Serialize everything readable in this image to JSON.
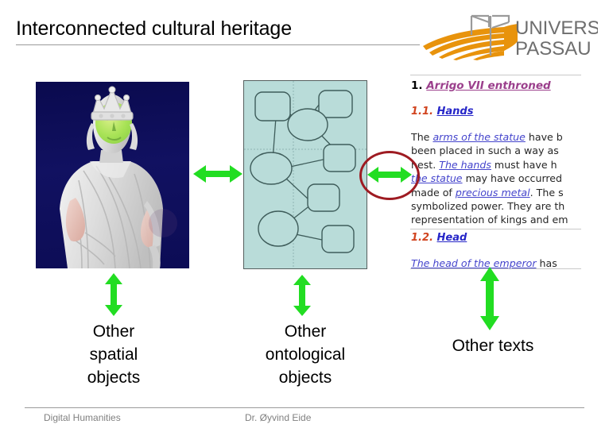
{
  "slide": {
    "title": "Interconnected cultural heritage"
  },
  "logo": {
    "line1": "UNIVERSITÄT",
    "line2": "PASSAU",
    "name": "university-passau-logo",
    "text_color": "#6e6e6e",
    "mark_color": "#e8930c"
  },
  "statue": {
    "name": "arrigo-vii-3d-scan",
    "background_color": "#0d0d5c",
    "marble_color": "#e2e2e2",
    "face_highlight_color": "#9fe05a",
    "arm_highlight_color": "#e8bfb5"
  },
  "ontology": {
    "name": "ontology-graph-panel",
    "panel_color": "#b9dcd9",
    "border_color": "#555f5e",
    "node_color": "#41615f"
  },
  "text_panel": {
    "heading1_number": "1.",
    "heading1_text": "Arrigo VII enthroned",
    "heading1_color": "#9b3f8c",
    "heading2a_number": "1.1.",
    "heading2a_text": "Hands",
    "heading2b_number": "1.2.",
    "heading2b_text": "Head",
    "heading_num_color": "#d1441f",
    "heading_link_color": "#2626c8",
    "paragraph1_lines": [
      {
        "parts": [
          {
            "t": "The ",
            "link": false
          },
          {
            "t": "arms of the statue",
            "link": true
          },
          {
            "t": " have b",
            "link": false
          }
        ]
      },
      {
        "parts": [
          {
            "t": "been placed in such a way as",
            "link": false
          }
        ]
      },
      {
        "parts": [
          {
            "t": "hest. ",
            "link": false
          },
          {
            "t": "The hands",
            "link": true
          },
          {
            "t": " must have h",
            "link": false
          }
        ]
      },
      {
        "parts": [
          {
            "t": "the statue",
            "link": true
          },
          {
            "t": " may have occurred",
            "link": false
          }
        ]
      },
      {
        "parts": [
          {
            "t": "made of ",
            "link": false
          },
          {
            "t": "precious metal",
            "link": true
          },
          {
            "t": ". The s",
            "link": false
          }
        ]
      },
      {
        "parts": [
          {
            "t": "symbolized power. They are th",
            "link": false
          }
        ]
      },
      {
        "parts": [
          {
            "t": "representation of kings and em",
            "link": false
          }
        ]
      }
    ],
    "paragraph2_lines": [
      {
        "parts": [
          {
            "t": "The head of the emperor",
            "link": true
          },
          {
            "t": " has",
            "link": false
          }
        ]
      }
    ]
  },
  "arrows": {
    "color": "#22dd22",
    "statue_to_ontology": "double-headed-horizontal-arrow",
    "ontology_to_text": "double-headed-horizontal-arrow",
    "statue_to_spatial": "double-headed-vertical-arrow",
    "ontology_to_objects": "double-headed-vertical-arrow",
    "text_to_texts": "double-headed-vertical-arrow"
  },
  "captions": {
    "spatial": "Other\nspatial\nobjects",
    "spatial_lines": [
      "Other",
      "spatial",
      "objects"
    ],
    "ontological_lines": [
      "Other",
      "ontological",
      "objects"
    ],
    "texts": "Other texts"
  },
  "footer": {
    "left": "Digital Humanities",
    "center": "Dr. Øyvind Eide"
  }
}
